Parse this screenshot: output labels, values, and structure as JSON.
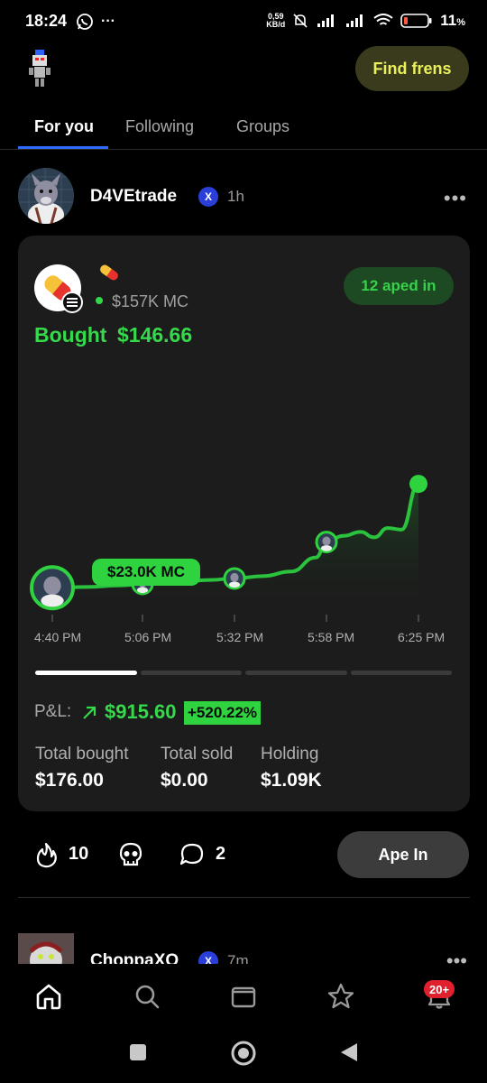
{
  "status_bar": {
    "time": "18:24",
    "more": "···",
    "net_speed_value": "0,59",
    "net_speed_unit": "KB/d",
    "battery": "11",
    "battery_unit": "%"
  },
  "header": {
    "find_frens_label": "Find frens"
  },
  "tabs": [
    {
      "label": "For you",
      "active": true
    },
    {
      "label": "Following",
      "active": false
    },
    {
      "label": "Groups",
      "active": false
    }
  ],
  "post": {
    "author": "D4VEtrade",
    "platform_badge": "X",
    "time": "1h",
    "more": "•••",
    "card": {
      "token_emoji_icon": "pill-icon",
      "market_cap": "$157K MC",
      "aped_in": "12 aped in",
      "bought_label": "Bought",
      "bought_amount": "$146.66",
      "entry_mc_label": "$23.0K MC",
      "pnl_label": "P&L:",
      "pnl_value": "$915.60",
      "pnl_percent": "+520.22%",
      "stats": [
        {
          "label": "Total bought",
          "value": "$176.00"
        },
        {
          "label": "Total sold",
          "value": "$0.00"
        },
        {
          "label": "Holding",
          "value": "$1.09K"
        }
      ],
      "pager_active_index": 0,
      "pager_count": 4
    },
    "actions": {
      "fire_count": "10",
      "comment_count": "2",
      "ape_in_label": "Ape In"
    }
  },
  "next_post": {
    "author": "ChoppaXO",
    "platform_badge": "X",
    "time": "7m",
    "more": "•••"
  },
  "bottom_nav": {
    "items": [
      "home-icon",
      "search-icon",
      "wallet-icon",
      "star-icon",
      "bell-icon"
    ],
    "notification_badge": "20+"
  },
  "colors": {
    "accent_green": "#35d94b",
    "find_frens_text": "#e9f05a",
    "tab_underline": "#2f6bff",
    "badge_red": "#e0202c"
  },
  "chart_data": {
    "type": "line",
    "x_tick_labels": [
      "4:40 PM",
      "5:06 PM",
      "5:32 PM",
      "5:58 PM",
      "6:25 PM"
    ],
    "x": [
      "4:35 PM",
      "4:40 PM",
      "4:50 PM",
      "5:00 PM",
      "5:06 PM",
      "5:15 PM",
      "5:25 PM",
      "5:32 PM",
      "5:40 PM",
      "5:48 PM",
      "5:55 PM",
      "5:58 PM",
      "6:03 PM",
      "6:08 PM",
      "6:12 PM",
      "6:16 PM",
      "6:20 PM",
      "6:25 PM"
    ],
    "values": [
      10,
      23,
      24,
      26,
      28,
      30,
      33,
      35,
      38,
      44,
      62,
      82,
      90,
      95,
      88,
      100,
      98,
      157
    ],
    "series": [
      {
        "values": [
          10,
          23,
          24,
          26,
          28,
          30,
          33,
          35,
          38,
          44,
          62,
          82,
          90,
          95,
          88,
          100,
          98,
          157
        ]
      }
    ],
    "y_unit": "$K MC",
    "entry_marker_value": "$23.0K MC",
    "trade_markers_x": [
      "4:40 PM",
      "5:06 PM",
      "5:32 PM",
      "5:58 PM"
    ],
    "last_point_x": "6:25 PM",
    "ylim": [
      0,
      170
    ],
    "grid": false,
    "legend": "none"
  }
}
